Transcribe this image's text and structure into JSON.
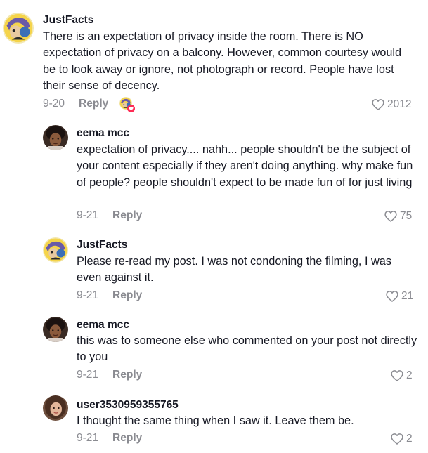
{
  "comments": [
    {
      "username": "JustFacts",
      "text": "There is an expectation of privacy inside the room. There is NO expectation of privacy on a balcony. However, common courtesy would be to look away or ignore, not photograph or record. People have lost their sense of decency.",
      "date": "9-20",
      "reply_label": "Reply",
      "likes": "2012",
      "avatar_icon": "justfacts-avatar",
      "creator_liked": true
    },
    {
      "username": "eema mcc",
      "text": "expectation of privacy.... nahh... people shouldn't be the subject of your content especially if they aren't doing anything. why make fun of people? people shouldn't expect to be made fun of for just living",
      "date": "9-21",
      "reply_label": "Reply",
      "likes": "75",
      "avatar_icon": "eema-avatar"
    },
    {
      "username": "JustFacts",
      "text": "Please re-read my post. I was not condoning the filming, I was even against it.",
      "date": "9-21",
      "reply_label": "Reply",
      "likes": "21",
      "avatar_icon": "justfacts-avatar"
    },
    {
      "username": "eema mcc",
      "text": "this was to someone else who commented on your post not directly to you",
      "date": "9-21",
      "reply_label": "Reply",
      "likes": "2",
      "avatar_icon": "eema-avatar"
    },
    {
      "username": "user3530959355765",
      "text": "I thought the same thing when I saw it. Leave them be.",
      "date": "9-21",
      "reply_label": "Reply",
      "likes": "2",
      "avatar_icon": "user-avatar"
    }
  ],
  "colors": {
    "text": "#161823",
    "muted": "#8a8b91",
    "creator_badge": "#fe2c55"
  }
}
